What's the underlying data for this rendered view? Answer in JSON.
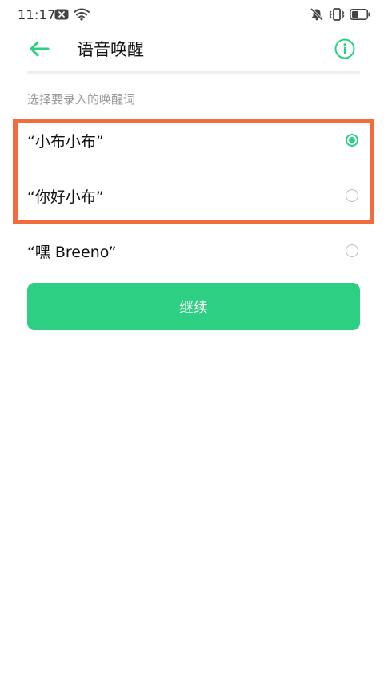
{
  "status_bar": {
    "time": "11:17",
    "left_icons": [
      "notification-x-icon",
      "wifi-icon"
    ],
    "right_icons": [
      "mute-icon",
      "vibrate-icon",
      "battery-icon"
    ]
  },
  "header": {
    "title": "语音唤醒",
    "back_icon": "back-arrow-icon",
    "info_icon": "info-icon",
    "accent_color": "#2dcf82"
  },
  "section": {
    "label": "选择要录入的唤醒词"
  },
  "options": [
    {
      "label": "“小布小布”",
      "selected": true
    },
    {
      "label": "“你好小布”",
      "selected": false
    },
    {
      "label": "“嘿 Breeno”",
      "selected": false
    }
  ],
  "continue_button": {
    "label": "继续",
    "color": "#2dcf82"
  },
  "highlight": {
    "color": "#f26c3e"
  }
}
